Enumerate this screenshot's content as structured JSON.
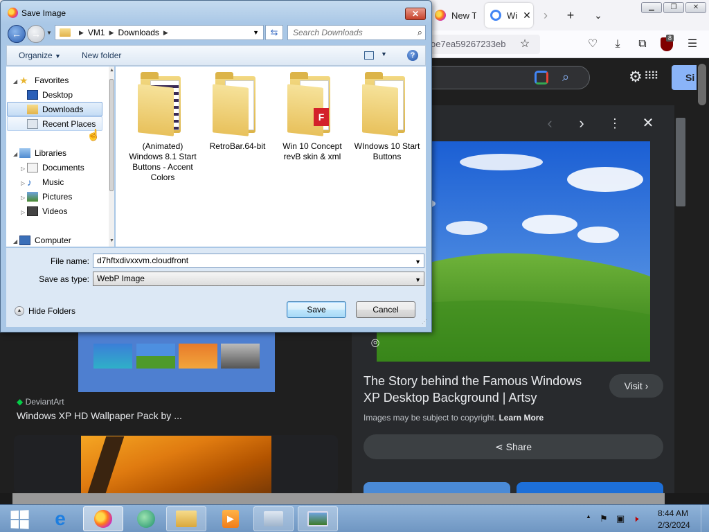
{
  "browser": {
    "tabs": [
      {
        "label": "New T"
      },
      {
        "label": "Wi"
      }
    ],
    "url": "oe7ea59267233eb",
    "extension_badge": "8",
    "signin_label": "Si",
    "preview": {
      "title": "The Story behind the Famous Windows XP Desktop Background | Artsy",
      "visit_label": "Visit",
      "copyright_text": "Images may be subject to copyright.",
      "learn_more": "Learn More",
      "share_label": "Share"
    },
    "results": [
      {
        "source": "DeviantArt",
        "title": "Windows XP HD Wallpaper Pack by ..."
      }
    ]
  },
  "dialog": {
    "title": "Save Image",
    "breadcrumb": [
      "VM1",
      "Downloads"
    ],
    "search_placeholder": "Search Downloads",
    "toolbar": {
      "organize": "Organize",
      "new_folder": "New folder"
    },
    "nav": {
      "favorites": "Favorites",
      "desktop": "Desktop",
      "downloads": "Downloads",
      "recent_places": "Recent Places",
      "libraries": "Libraries",
      "documents": "Documents",
      "music": "Music",
      "pictures": "Pictures",
      "videos": "Videos",
      "computer": "Computer"
    },
    "files": [
      {
        "name": "(Animated) Windows 8.1 Start Buttons - Accent Colors"
      },
      {
        "name": "RetroBar.64-bit"
      },
      {
        "name": "Win 10 Concept revB skin & xml"
      },
      {
        "name": "WIndows 10 Start Buttons"
      }
    ],
    "file_name_label": "File name:",
    "file_name_value": "d7hftxdivxxvm.cloudfront",
    "save_type_label": "Save as type:",
    "save_type_value": "WebP Image",
    "hide_folders": "Hide Folders",
    "save_button": "Save",
    "cancel_button": "Cancel"
  },
  "taskbar": {
    "time": "8:44 AM",
    "date": "2/3/2024"
  }
}
